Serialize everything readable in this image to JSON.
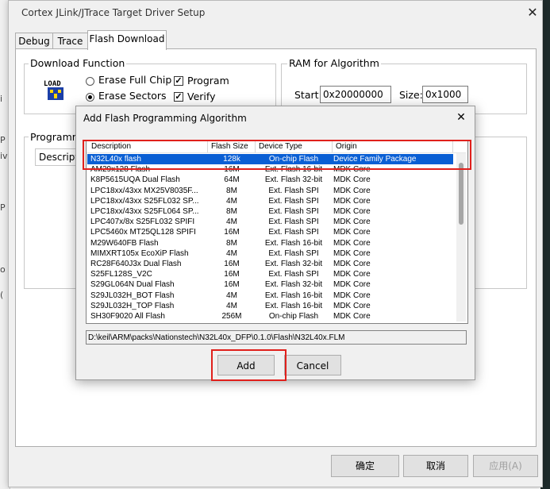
{
  "window": {
    "title": "Cortex JLink/JTrace Target Driver Setup",
    "close_icon": "close-icon",
    "tabs": [
      "Debug",
      "Trace",
      "Flash Download"
    ],
    "active_tab": "Flash Download"
  },
  "background": {
    "left_glyphs": [
      "i",
      "P",
      "iv",
      "P",
      "(",
      "o"
    ]
  },
  "download_function": {
    "title": "Download Function",
    "icon_text": "LOAD",
    "options": [
      {
        "label": "Erase Full Chip",
        "selected": false
      },
      {
        "label": "Erase Sectors",
        "selected": true
      }
    ],
    "checks": [
      {
        "label": "Program",
        "checked": true
      },
      {
        "label": "Verify",
        "checked": true
      }
    ]
  },
  "ram": {
    "title": "RAM for Algorithm",
    "start_label": "Start:",
    "start_value": "0x20000000",
    "size_label": "Size:",
    "size_value": "0x1000"
  },
  "programming": {
    "title": "Programm",
    "col": "Descripti"
  },
  "footer": {
    "ok": "确定",
    "cancel": "取消",
    "apply": "应用(A)"
  },
  "dialog": {
    "title": "Add Flash Programming Algorithm",
    "columns": [
      "Description",
      "Flash Size",
      "Device Type",
      "Origin"
    ],
    "rows": [
      {
        "desc": "N32L40x flash",
        "size": "128k",
        "type": "On-chip Flash",
        "origin": "Device Family Package",
        "selected": true
      },
      {
        "desc": "AM29x128 Flash",
        "size": "16M",
        "type": "Ext. Flash 16-bit",
        "origin": "MDK Core"
      },
      {
        "desc": "K8P5615UQA Dual Flash",
        "size": "64M",
        "type": "Ext. Flash 32-bit",
        "origin": "MDK Core"
      },
      {
        "desc": "LPC18xx/43xx MX25V8035F...",
        "size": "8M",
        "type": "Ext. Flash SPI",
        "origin": "MDK Core"
      },
      {
        "desc": "LPC18xx/43xx S25FL032 SP...",
        "size": "4M",
        "type": "Ext. Flash SPI",
        "origin": "MDK Core"
      },
      {
        "desc": "LPC18xx/43xx S25FL064 SP...",
        "size": "8M",
        "type": "Ext. Flash SPI",
        "origin": "MDK Core"
      },
      {
        "desc": "LPC407x/8x S25FL032 SPIFI",
        "size": "4M",
        "type": "Ext. Flash SPI",
        "origin": "MDK Core"
      },
      {
        "desc": "LPC5460x MT25QL128 SPIFI",
        "size": "16M",
        "type": "Ext. Flash SPI",
        "origin": "MDK Core"
      },
      {
        "desc": "M29W640FB Flash",
        "size": "8M",
        "type": "Ext. Flash 16-bit",
        "origin": "MDK Core"
      },
      {
        "desc": "MIMXRT105x EcoXiP Flash",
        "size": "4M",
        "type": "Ext. Flash SPI",
        "origin": "MDK Core"
      },
      {
        "desc": "RC28F640J3x Dual Flash",
        "size": "16M",
        "type": "Ext. Flash 32-bit",
        "origin": "MDK Core"
      },
      {
        "desc": "S25FL128S_V2C",
        "size": "16M",
        "type": "Ext. Flash SPI",
        "origin": "MDK Core"
      },
      {
        "desc": "S29GL064N Dual Flash",
        "size": "16M",
        "type": "Ext. Flash 32-bit",
        "origin": "MDK Core"
      },
      {
        "desc": "S29JL032H_BOT Flash",
        "size": "4M",
        "type": "Ext. Flash 16-bit",
        "origin": "MDK Core"
      },
      {
        "desc": "S29JL032H_TOP Flash",
        "size": "4M",
        "type": "Ext. Flash 16-bit",
        "origin": "MDK Core"
      },
      {
        "desc": "SH30F9020 All Flash",
        "size": "256M",
        "type": "On-chip Flash",
        "origin": "MDK Core"
      },
      {
        "desc": "",
        "size": "",
        "type": "",
        "origin": ""
      }
    ],
    "path": "D:\\keil\\ARM\\packs\\Nationstech\\N32L40x_DFP\\0.1.0\\Flash\\N32L40x.FLM",
    "add": "Add",
    "cancel": "Cancel"
  },
  "colors": {
    "selection": "#0a5fd4",
    "highlight_box": "#e0201c",
    "dialog_bg": "#f0f0f0"
  }
}
